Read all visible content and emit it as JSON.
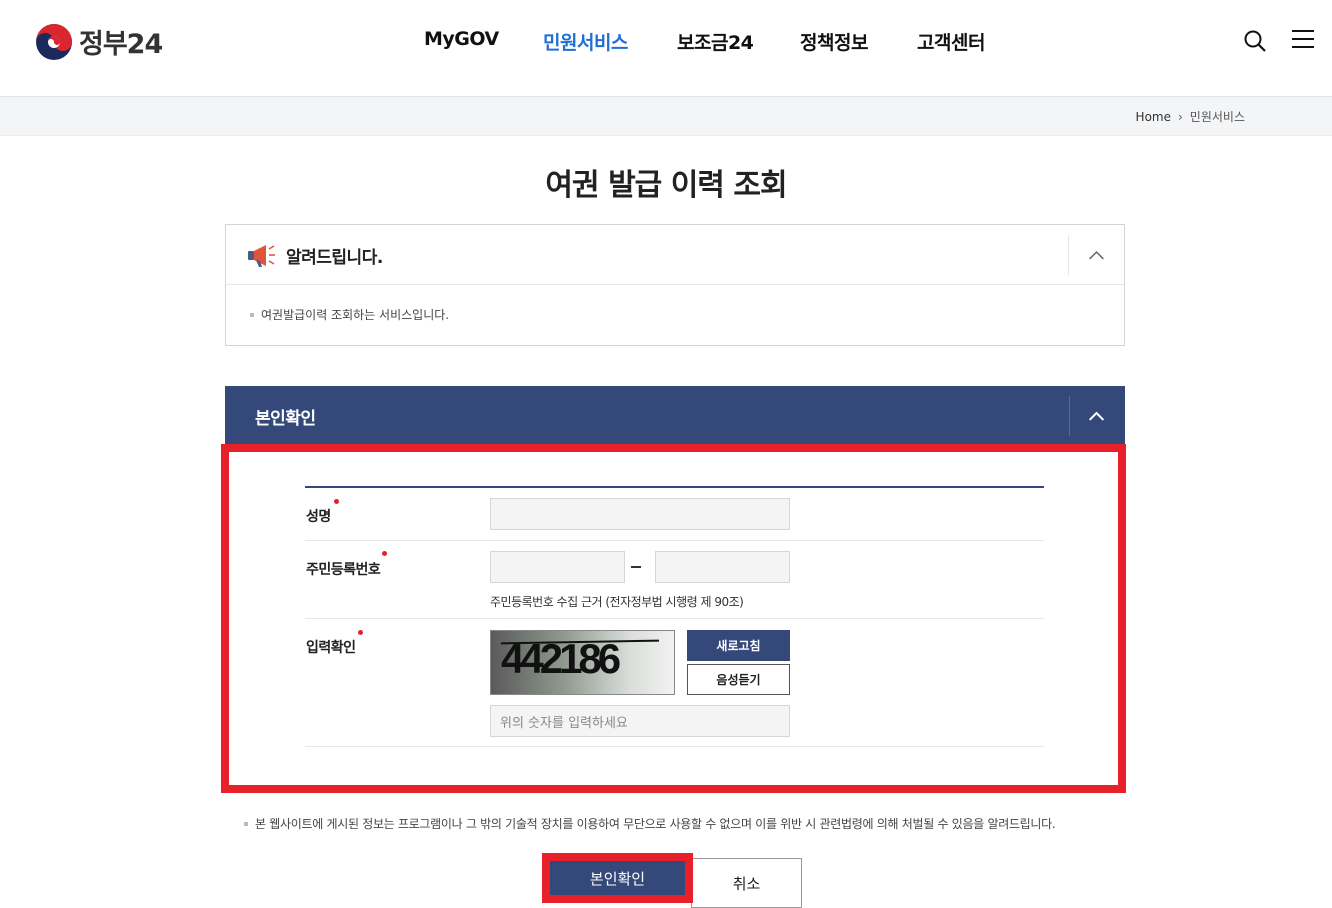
{
  "brand": {
    "name": "정부24"
  },
  "nav": {
    "items": [
      {
        "label": "MyGOV",
        "active": false
      },
      {
        "label": "민원서비스",
        "active": true
      },
      {
        "label": "보조금24",
        "active": false
      },
      {
        "label": "정책정보",
        "active": false
      },
      {
        "label": "고객센터",
        "active": false
      }
    ],
    "icons": {
      "search": "search-icon",
      "menu": "hamburger-menu-icon"
    }
  },
  "breadcrumb": {
    "home": "Home",
    "current": "민원서비스"
  },
  "page": {
    "title": "여권 발급 이력 조회"
  },
  "notice": {
    "title": "알려드립니다.",
    "items": [
      "여권발급이력 조회하는 서비스입니다."
    ]
  },
  "verify": {
    "title": "본인확인",
    "fields": {
      "name": {
        "label": "성명",
        "value": ""
      },
      "rrn": {
        "label": "주민등록번호",
        "front": "",
        "back": "",
        "help": "주민등록번호 수집 근거 (전자정부법 시행령 제 90조)"
      },
      "captcha": {
        "label": "입력확인",
        "image_text": "442186",
        "refresh_label": "새로고침",
        "audio_label": "음성듣기",
        "placeholder": "위의 숫자를 입력하세요"
      }
    }
  },
  "footnote": "본 웹사이트에 게시된 정보는 프로그램이나 그 밖의 기술적 장치를 이용하여 무단으로 사용할 수 없으며 이를 위반 시 관련법령에 의해 처벌될 수 있음을 알려드립니다.",
  "actions": {
    "confirm": "본인확인",
    "cancel": "취소"
  },
  "colors": {
    "primary": "#34497a",
    "accent": "#1f6fd6",
    "highlight": "#e8202a"
  }
}
